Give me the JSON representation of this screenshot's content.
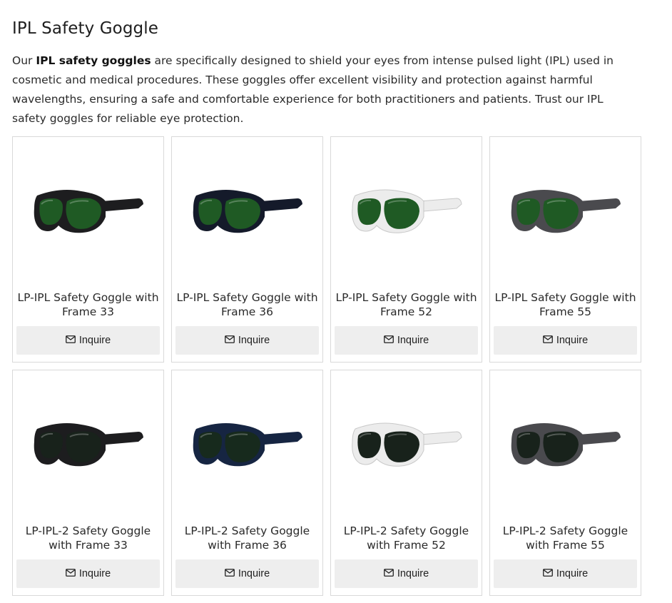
{
  "page": {
    "title": "IPL Safety Goggle",
    "intro_lead": "Our ",
    "intro_bold": "IPL safety goggles",
    "intro_rest": " are specifically designed to shield your eyes from intense pulsed light (IPL) used in cosmetic and medical procedures. These goggles offer excellent visibility and protection against harmful wavelengths, ensuring a safe and comfortable experience for both practitioners and patients. Trust our IPL safety goggles for reliable eye protection."
  },
  "products": [
    {
      "name": "LP-IPL Safety Goggle with Frame 33",
      "button": "Inquire",
      "frame_color": "#1d1d1f",
      "lens_color": "#1f5a24"
    },
    {
      "name": "LP-IPL Safety Goggle with Frame 36",
      "button": "Inquire",
      "frame_color": "#141a2a",
      "lens_color": "#1f5a24"
    },
    {
      "name": "LP-IPL Safety Goggle with Frame 52",
      "button": "Inquire",
      "frame_color": "#ececec",
      "lens_color": "#1f5a24"
    },
    {
      "name": "LP-IPL Safety Goggle with Frame 55",
      "button": "Inquire",
      "frame_color": "#4a4a4e",
      "lens_color": "#1f5a24"
    },
    {
      "name": "LP-IPL-2 Safety Goggle with Frame 33",
      "button": "Inquire",
      "frame_color": "#1d1d1f",
      "lens_color": "#18221b"
    },
    {
      "name": "LP-IPL-2 Safety Goggle with Frame 36",
      "button": "Inquire",
      "frame_color": "#162542",
      "lens_color": "#172a1d"
    },
    {
      "name": "LP-IPL-2 Safety Goggle with Frame 52",
      "button": "Inquire",
      "frame_color": "#ececec",
      "lens_color": "#18221b"
    },
    {
      "name": "LP-IPL-2 Safety Goggle with Frame 55",
      "button": "Inquire",
      "frame_color": "#4a4a4e",
      "lens_color": "#18221b"
    }
  ],
  "icons": {
    "inquire": "envelope-icon",
    "product": "goggle-image"
  }
}
